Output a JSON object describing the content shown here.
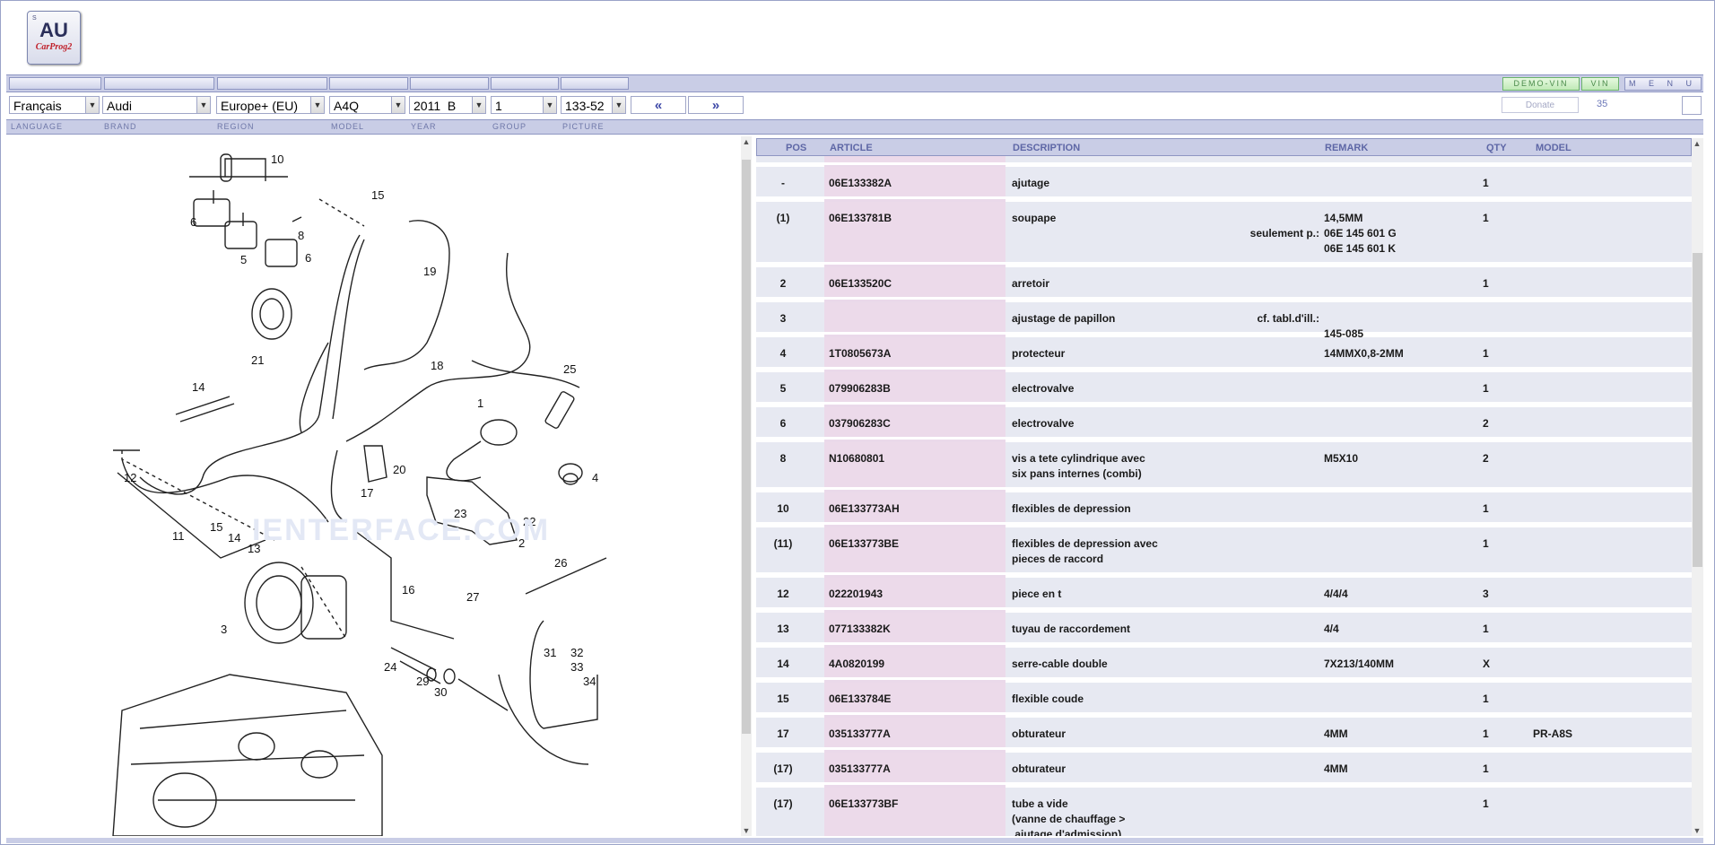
{
  "logo": {
    "main": "AU",
    "sub": "CarProg2",
    "corner": "S"
  },
  "topbar": {
    "demo_vin": "DEMO-VIN",
    "vin": "VIN",
    "menu": "M E N U"
  },
  "selectors": {
    "language": "Français",
    "brand": "Audi",
    "region": "Europe+ (EU)",
    "model": "A4Q",
    "year": "2011  B",
    "group": "1",
    "picture": "133-52",
    "prev": "«",
    "next": "»",
    "donate": "Donate",
    "count": "35"
  },
  "labels": {
    "language": "LANGUAGE",
    "brand": "BRAND",
    "region": "REGION",
    "model": "MODEL",
    "year": "YEAR",
    "group": "GROUP",
    "picture": "PICTURE"
  },
  "watermark": "IENTERFACE.COM",
  "table": {
    "headers": {
      "pos": "POS",
      "article": "ARTICLE",
      "description": "DESCRIPTION",
      "remark": "REMARK",
      "qty": "QTY",
      "model": "MODEL"
    },
    "rows": [
      {
        "pos": "-",
        "article": "06E133382A",
        "desc": "ajutage",
        "remark": "",
        "remark_prefix": "",
        "qty": "1",
        "model": ""
      },
      {
        "pos": "(1)",
        "article": "06E133781B",
        "desc": "soupape",
        "remark": "14,5MM\n06E 145 601 G\n06E 145 601 K",
        "remark_prefix": "seulement p.:",
        "qty": "1",
        "model": ""
      },
      {
        "pos": "2",
        "article": "06E133520C",
        "desc": "arretoir",
        "remark": "",
        "remark_prefix": "",
        "qty": "1",
        "model": ""
      },
      {
        "pos": "3",
        "article": "",
        "desc": "ajustage de papillon",
        "remark": "145-085",
        "remark_prefix": "cf. tabl.d'ill.:",
        "qty": "",
        "model": ""
      },
      {
        "pos": "4",
        "article": "1T0805673A",
        "desc": "protecteur",
        "remark": "14MMX0,8-2MM",
        "remark_prefix": "",
        "qty": "1",
        "model": ""
      },
      {
        "pos": "5",
        "article": "079906283B",
        "desc": "electrovalve",
        "remark": "",
        "remark_prefix": "",
        "qty": "1",
        "model": ""
      },
      {
        "pos": "6",
        "article": "037906283C",
        "desc": "electrovalve",
        "remark": "",
        "remark_prefix": "",
        "qty": "2",
        "model": ""
      },
      {
        "pos": "8",
        "article": "N10680801",
        "desc": "vis a tete cylindrique avec\nsix pans internes (combi)",
        "remark": "M5X10",
        "remark_prefix": "",
        "qty": "2",
        "model": ""
      },
      {
        "pos": "10",
        "article": "06E133773AH",
        "desc": "flexibles de depression",
        "remark": "",
        "remark_prefix": "",
        "qty": "1",
        "model": ""
      },
      {
        "pos": "(11)",
        "article": "06E133773BE",
        "desc": "flexibles de depression avec\npieces de raccord",
        "remark": "",
        "remark_prefix": "",
        "qty": "1",
        "model": ""
      },
      {
        "pos": "12",
        "article": "022201943",
        "desc": "piece en t",
        "remark": "4/4/4",
        "remark_prefix": "",
        "qty": "3",
        "model": ""
      },
      {
        "pos": "13",
        "article": "077133382K",
        "desc": "tuyau de raccordement",
        "remark": "4/4",
        "remark_prefix": "",
        "qty": "1",
        "model": ""
      },
      {
        "pos": "14",
        "article": "4A0820199",
        "desc": "serre-cable double",
        "remark": "7X213/140MM",
        "remark_prefix": "",
        "qty": "X",
        "model": ""
      },
      {
        "pos": "15",
        "article": "06E133784E",
        "desc": "flexible coude",
        "remark": "",
        "remark_prefix": "",
        "qty": "1",
        "model": ""
      },
      {
        "pos": "17",
        "article": "035133777A",
        "desc": "obturateur",
        "remark": "4MM",
        "remark_prefix": "",
        "qty": "1",
        "model": "PR-A8S"
      },
      {
        "pos": "(17)",
        "article": "035133777A",
        "desc": "obturateur",
        "remark": "4MM",
        "remark_prefix": "",
        "qty": "1",
        "model": ""
      },
      {
        "pos": "(17)",
        "article": "06E133773BF",
        "desc": "tube a vide\n(vanne de chauffage >\n ajutage d'admission)",
        "remark": "",
        "remark_prefix": "",
        "qty": "1",
        "model": ""
      }
    ]
  },
  "diagram_labels": [
    "10",
    "15",
    "6",
    "8",
    "5",
    "6",
    "19",
    "21",
    "18",
    "25",
    "14",
    "1",
    "12",
    "20",
    "4",
    "17",
    "23",
    "22",
    "2",
    "11",
    "15",
    "14",
    "13",
    "26",
    "16",
    "27",
    "3",
    "31",
    "32",
    "33",
    "34",
    "24",
    "29",
    "30"
  ]
}
